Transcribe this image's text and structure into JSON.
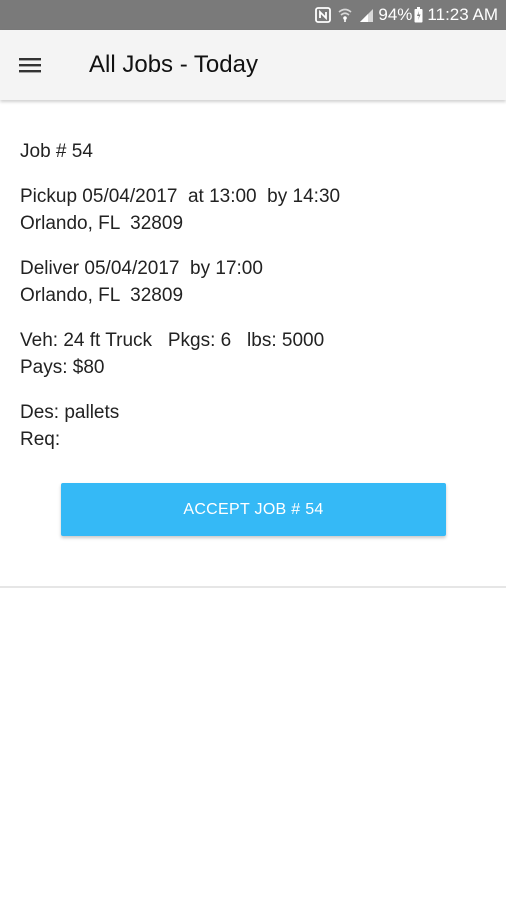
{
  "status_bar": {
    "battery_percent": "94%",
    "time": "11:23 AM",
    "icons": [
      "nfc-icon",
      "wifi-icon",
      "signal-icon",
      "battery-icon"
    ]
  },
  "app_bar": {
    "title": "All Jobs - Today",
    "menu_icon": "hamburger-menu-icon"
  },
  "job": {
    "number_line": "Job # 54",
    "pickup_line": "Pickup 05/04/2017  at 13:00  by 14:30",
    "pickup_location": "Orlando, FL  32809",
    "deliver_line": "Deliver 05/04/2017  by 17:00",
    "deliver_location": "Orlando, FL  32809",
    "vehicle_line": "Veh: 24 ft Truck   Pkgs: 6   lbs: 5000",
    "pays_line": "Pays: $80",
    "description_line": "Des: pallets",
    "requirements_line": "Req:",
    "accept_button_label": "ACCEPT JOB # 54"
  },
  "colors": {
    "status_bar": "#7a7a7a",
    "app_bar": "#f4f4f4",
    "accent_button": "#35b9f6",
    "divider": "#e6e6e6"
  }
}
